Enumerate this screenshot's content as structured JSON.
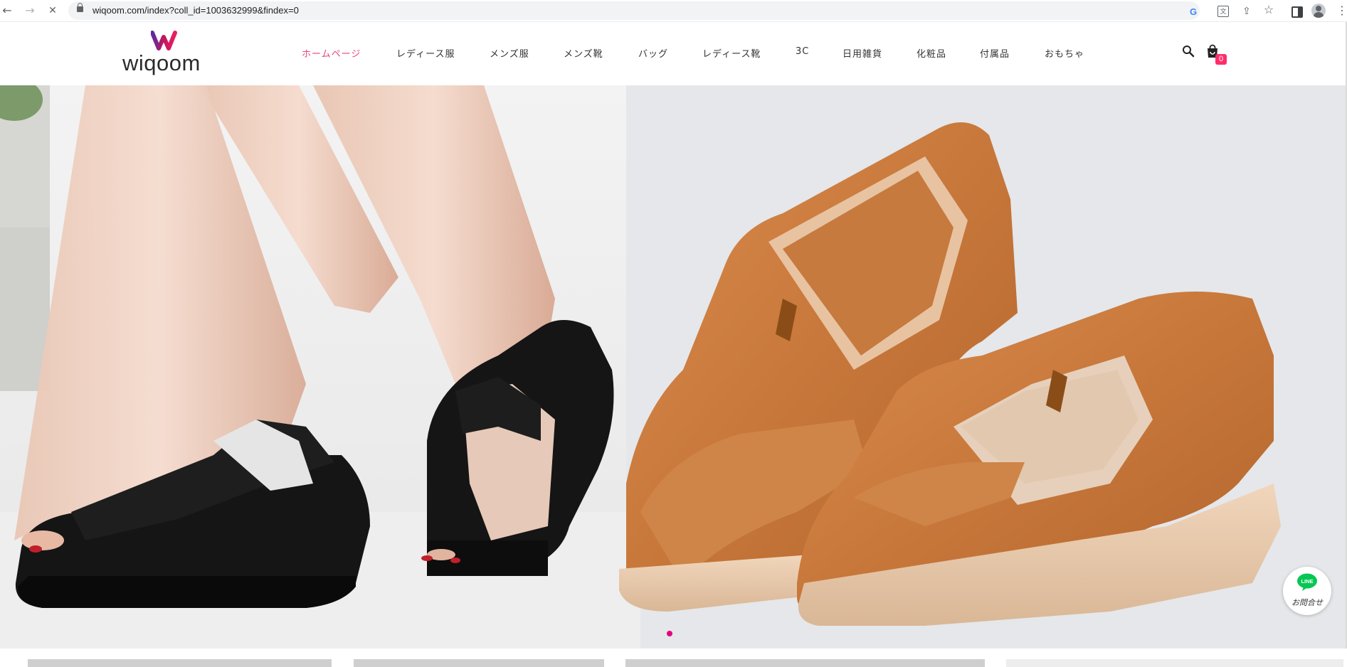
{
  "browser": {
    "url": "wiqoom.com/index?coll_id=1003632999&findex=0",
    "back_icon": "←",
    "forward_icon": "→",
    "stop_icon": "✕",
    "google_icon": "G",
    "translate_icon": "文",
    "share_icon": "⇪",
    "star_icon": "☆",
    "menu_icon": "⋮"
  },
  "site": {
    "logo_text": "wiqoom",
    "nav": [
      {
        "label": "ホームページ",
        "active": true
      },
      {
        "label": "レディース服"
      },
      {
        "label": "メンズ服"
      },
      {
        "label": "メンズ靴"
      },
      {
        "label": "バッグ"
      },
      {
        "label": "レディース靴"
      },
      {
        "label": "3C"
      },
      {
        "label": "日用雑貨"
      },
      {
        "label": "化粧品"
      },
      {
        "label": "付属品"
      },
      {
        "label": "おもちゃ"
      }
    ],
    "cart_count": "0"
  },
  "hero": {
    "slide_count": 1,
    "active_slide": 1
  },
  "line_widget": {
    "label": "お問合せ",
    "icon_text": "LINE"
  },
  "colors": {
    "accent": "#e8457a",
    "badge": "#ff2d6b",
    "dot": "#e6007e",
    "line_green": "#06c755"
  }
}
